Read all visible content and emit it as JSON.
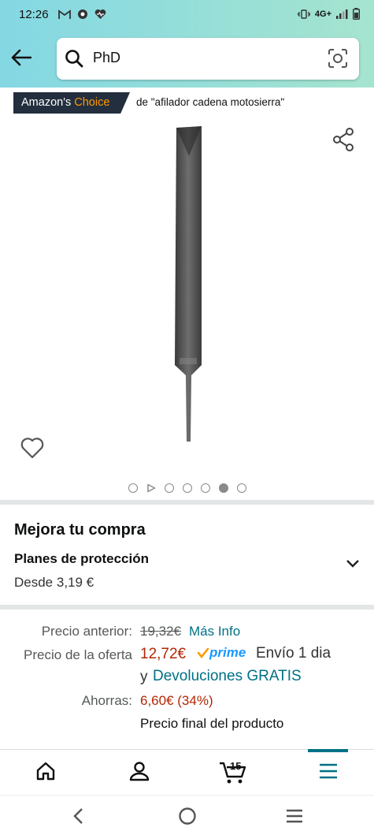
{
  "status_bar": {
    "time": "12:26",
    "network": "4G+",
    "left_icons": [
      "gmail-icon",
      "chrome-icon",
      "heart-health-icon"
    ],
    "right_icons": [
      "vibrate-icon",
      "signal-icon",
      "battery-icon"
    ]
  },
  "search": {
    "query": "PhD"
  },
  "choice": {
    "badge_prefix": "Amazon's",
    "badge_word": "Choice",
    "term": "de \"afilador cadena motosierra\"",
    "accent": "#ff9900"
  },
  "gallery": {
    "slides": 7,
    "active_index": 5
  },
  "upgrade": {
    "title": "Mejora tu compra",
    "plan_title": "Planes de protección",
    "plan_price": "Desde 3,19 €"
  },
  "pricing": {
    "old_label": "Precio anterior:",
    "old_price": "19,32€",
    "more_info": "Más Info",
    "deal_label": "Precio de la oferta",
    "deal_price": "12,72€",
    "prime": "prime",
    "shipping": "Envío 1 dia",
    "and": "y",
    "returns": "Devoluciones GRATIS",
    "save_label": "Ahorras:",
    "save_value": "6,60€ (34%)",
    "final_note": "Precio final del producto"
  },
  "bottom_nav": {
    "cart_count": "15",
    "items": [
      "home-icon",
      "account-icon",
      "cart-icon",
      "menu-icon"
    ]
  }
}
